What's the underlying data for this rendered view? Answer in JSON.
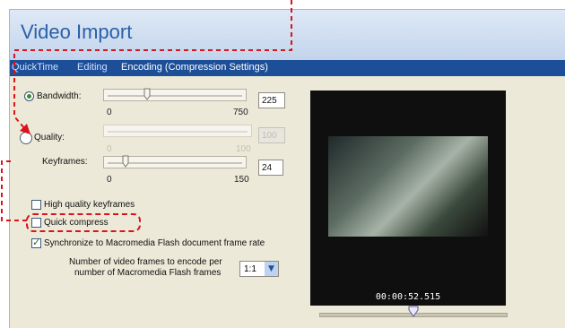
{
  "window": {
    "title": "Video Import"
  },
  "tabs": [
    {
      "label": "QuickTime"
    },
    {
      "label": "Editing"
    },
    {
      "label": "Encoding (Compression Settings)"
    }
  ],
  "settings": {
    "bandwidth": {
      "label": "Bandwidth:",
      "min": "0",
      "max": "750",
      "value": "225"
    },
    "quality": {
      "label": "Quality:",
      "min": "0",
      "max": "100",
      "value": "100"
    },
    "keyframes": {
      "label": "Keyframes:",
      "min": "0",
      "max": "150",
      "value": "24"
    },
    "high_quality_keyframes": {
      "label": "High quality keyframes",
      "checked": false
    },
    "quick_compress": {
      "label": "Quick compress",
      "checked": false
    },
    "sync_frame_rate": {
      "label": "Synchronize to Macromedia Flash document frame rate",
      "checked": true
    },
    "frames_ratio": {
      "label_line1": "Number of video frames to encode per",
      "label_line2": "number of Macromedia Flash frames",
      "value": "1:1"
    }
  },
  "preview": {
    "timecode": "00:00:52.515"
  },
  "colors": {
    "accent": "#1d4f98",
    "title": "#2a5fa8",
    "callout": "#d8141c"
  }
}
